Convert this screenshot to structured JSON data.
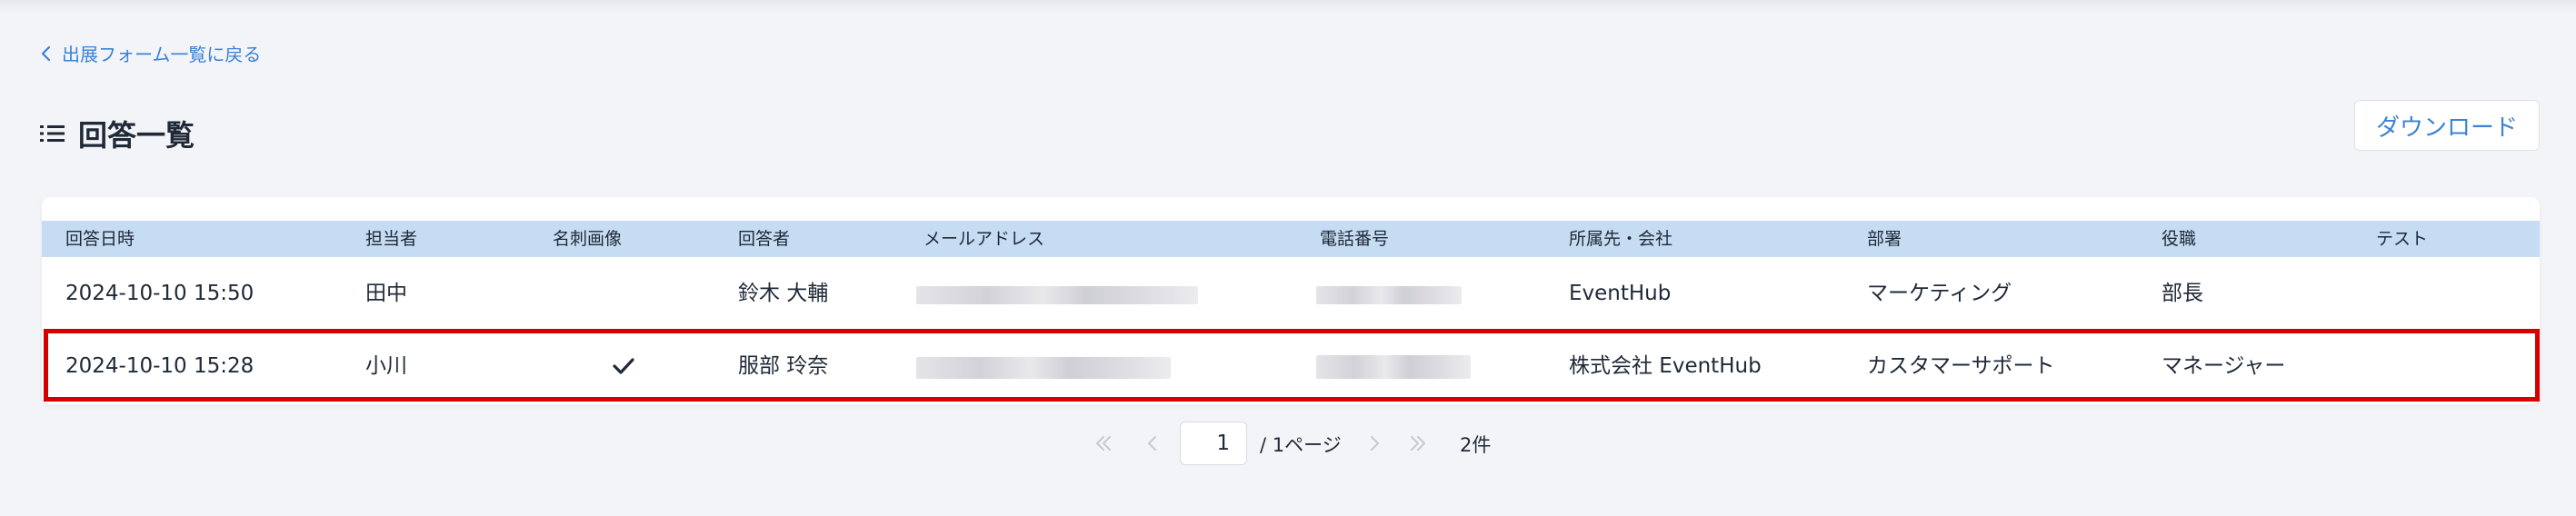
{
  "nav": {
    "back_label": "出展フォーム一覧に戻る"
  },
  "header": {
    "title": "回答一覧",
    "download_label": "ダウンロード"
  },
  "table": {
    "columns": [
      "回答日時",
      "担当者",
      "名刺画像",
      "回答者",
      "メールアドレス",
      "電話番号",
      "所属先・会社",
      "部署",
      "役職",
      "テスト"
    ],
    "rows": [
      {
        "answered_at": "2024-10-10 15:50",
        "staff": "田中",
        "card_image": "",
        "respondent": "鈴木 大輔",
        "email": "",
        "phone": "",
        "company": "EventHub",
        "department": "マーケティング",
        "position": "部長",
        "test": ""
      },
      {
        "answered_at": "2024-10-10 15:28",
        "staff": "小川",
        "card_image": "check-icon",
        "respondent": "服部 玲奈",
        "email": "",
        "phone": "",
        "company": "株式会社 EventHub",
        "department": "カスタマーサポート",
        "position": "マネージャー",
        "test": ""
      }
    ]
  },
  "pagination": {
    "current_page": "1",
    "total_pages_label": "/ 1ページ",
    "total_count_label": "2件"
  },
  "colors": {
    "accent": "#3b82d6",
    "header_bg": "#c6dcf3",
    "highlight": "#d40000",
    "background": "#f3f4f7"
  }
}
